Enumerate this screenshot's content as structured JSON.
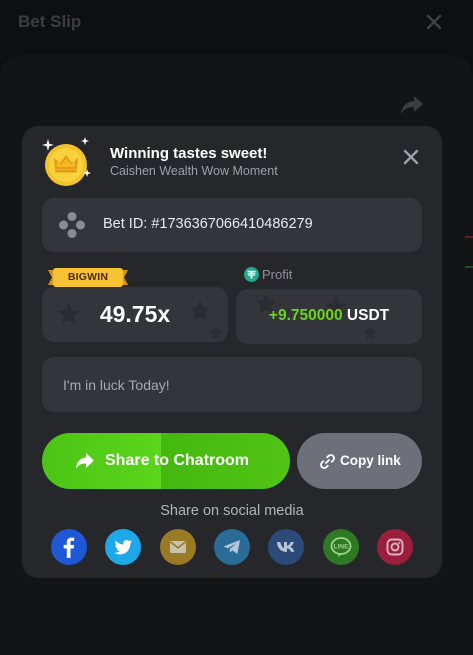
{
  "background": {
    "title": "Bet Slip"
  },
  "modal": {
    "title": "Winning tastes sweet!",
    "subtitle": "Caishen Wealth Wow Moment",
    "bet_id": "Bet ID: #1736367066410486279",
    "badge": "BIGWIN",
    "multiplier": "49.75x",
    "profit_label": "Profit",
    "profit_amount": "+9.750000",
    "profit_currency": "USDT",
    "message_placeholder": "I'm in luck Today!",
    "share_chatroom_label": "Share to Chatroom",
    "copy_link_label": "Copy link",
    "social_title": "Share on social media",
    "social_networks": [
      {
        "name": "facebook",
        "icon": "facebook-icon",
        "color": "#1f58d6"
      },
      {
        "name": "twitter",
        "icon": "twitter-icon",
        "color": "#1ea8ea"
      },
      {
        "name": "email",
        "icon": "email-icon",
        "color": "#9a7a25"
      },
      {
        "name": "telegram",
        "icon": "telegram-icon",
        "color": "#2a6b98"
      },
      {
        "name": "vk",
        "icon": "vk-icon",
        "color": "#2c4a78"
      },
      {
        "name": "line",
        "icon": "line-icon",
        "color": "#2e7a22"
      },
      {
        "name": "instagram",
        "icon": "instagram-icon",
        "color": "#9b1e3c"
      }
    ]
  },
  "colors": {
    "accent_green": "#5cd51c",
    "profit_green": "#6bd41c",
    "modal_bg": "#26272b",
    "card_bg": "#33353a"
  }
}
